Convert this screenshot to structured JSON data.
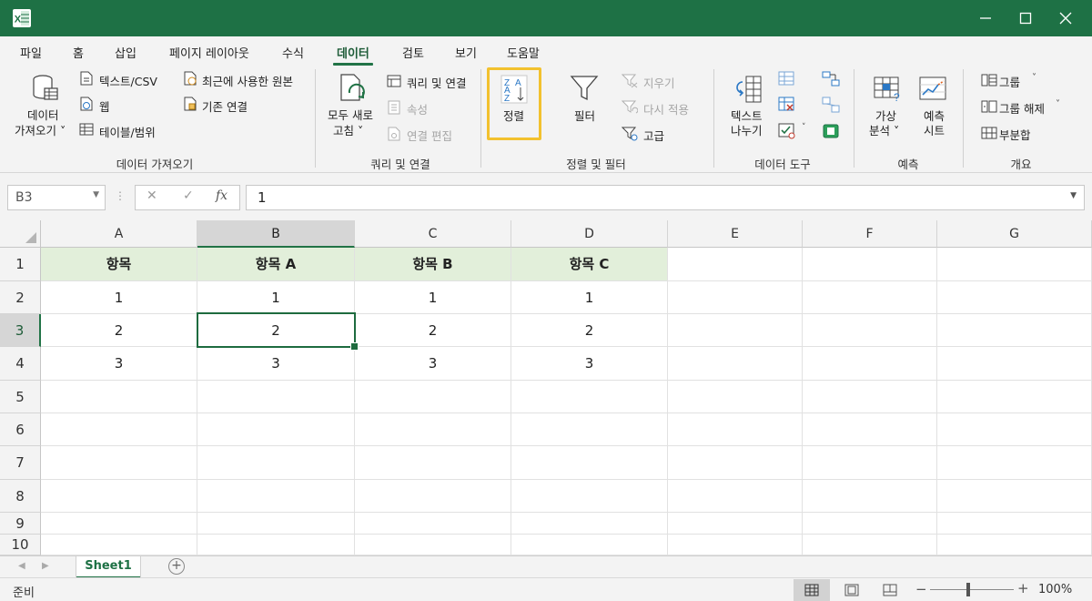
{
  "app": {
    "accent": "#1e7145",
    "logo_letter": "X"
  },
  "tabs": [
    {
      "label": "파일"
    },
    {
      "label": "홈"
    },
    {
      "label": "삽입"
    },
    {
      "label": "페이지 레이아웃"
    },
    {
      "label": "수식"
    },
    {
      "label": "데이터",
      "active": true
    },
    {
      "label": "검토"
    },
    {
      "label": "보기"
    },
    {
      "label": "도움말"
    }
  ],
  "ribbon": {
    "get_data": {
      "big_line1": "데이터",
      "big_line2": "가져오기 ˅",
      "text_csv": "텍스트/CSV",
      "web": "웹",
      "table_range": "테이블/범위",
      "recent_sources": "최근에 사용한 원본",
      "existing_conn": "기존 연결",
      "group_label": "데이터 가져오기"
    },
    "queries": {
      "refresh_line1": "모두 새로",
      "refresh_line2": "고침 ˅",
      "queries_conn": "쿼리 및 연결",
      "properties": "속성",
      "edit_links": "연결 편집",
      "group_label": "쿼리 및 연결"
    },
    "sort_filter": {
      "sort": "정렬",
      "filter": "필터",
      "clear": "지우기",
      "reapply": "다시 적용",
      "advanced": "고급",
      "group_label": "정렬 및 필터"
    },
    "data_tools": {
      "text_to_col_line1": "텍스트",
      "text_to_col_line2": "나누기",
      "group_label": "데이터 도구"
    },
    "forecast": {
      "whatif_line1": "가상",
      "whatif_line2": "분석 ˅",
      "sheet_line1": "예측",
      "sheet_line2": "시트",
      "group_label": "예측"
    },
    "outline": {
      "group": "그룹",
      "ungroup": "그룹 해제",
      "subtotal": "부분합",
      "group_label": "개요"
    }
  },
  "formula_bar": {
    "name_box": "B3",
    "cancel": "✕",
    "enter": "✓",
    "fx": "fx",
    "content": "1"
  },
  "grid": {
    "columns": [
      "A",
      "B",
      "C",
      "D",
      "E",
      "F",
      "G"
    ],
    "rows": [
      "1",
      "2",
      "3",
      "4",
      "5",
      "6",
      "7",
      "8",
      "9",
      "10"
    ],
    "selected_cell": "B3",
    "cells": [
      [
        "항목",
        "항목 A",
        "항목 B",
        "항목 C"
      ],
      [
        "1",
        "1",
        "1",
        "1"
      ],
      [
        "2",
        "2",
        "2",
        "2"
      ],
      [
        "3",
        "3",
        "3",
        "3"
      ]
    ],
    "header_fill": "#e2efda"
  },
  "sheets": [
    {
      "name": "Sheet1",
      "active": true
    }
  ],
  "status": {
    "text": "준비",
    "zoom_minus": "−",
    "zoom_plus": "+",
    "zoom": "100%"
  }
}
